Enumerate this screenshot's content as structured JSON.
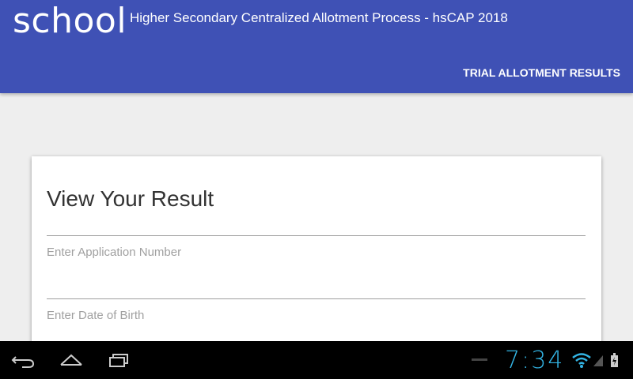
{
  "header": {
    "logo": "school",
    "title": "Higher Secondary Centralized Allotment Process - hsCAP 2018",
    "nav_link": "TRIAL ALLOTMENT RESULTS",
    "color": "#3f51b5"
  },
  "card": {
    "title": "View Your Result",
    "application_number_placeholder": "Enter Application Number",
    "date_of_birth_placeholder": "Enter Date of Birth"
  },
  "system_bar": {
    "time": "7:34",
    "icons": [
      "back-icon",
      "home-icon",
      "recent-apps-icon",
      "wifi-icon",
      "signal-icon",
      "battery-icon"
    ],
    "accent": "#33b5e5"
  }
}
